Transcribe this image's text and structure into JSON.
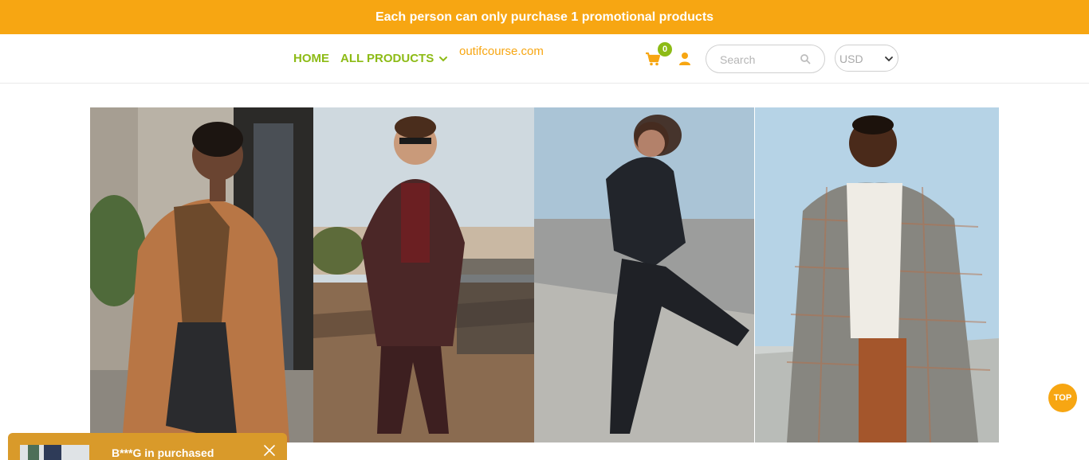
{
  "promo": {
    "text": "Each person can only purchase 1 promotional products"
  },
  "nav": {
    "home": "HOME",
    "all_products": "ALL PRODUCTS"
  },
  "site": {
    "name": "outifcourse.com"
  },
  "cart": {
    "count": "0",
    "icon": "cart-icon"
  },
  "account": {
    "icon": "user-icon"
  },
  "search": {
    "placeholder": "Search",
    "icon": "search-icon"
  },
  "currency": {
    "selected": "USD"
  },
  "scroll_top": {
    "label": "TOP"
  },
  "notification": {
    "text": "B***G in purchased"
  },
  "colors": {
    "accent_orange": "#f7a612",
    "nav_green": "#8dbb16",
    "popup_bg": "#d99a2a"
  }
}
